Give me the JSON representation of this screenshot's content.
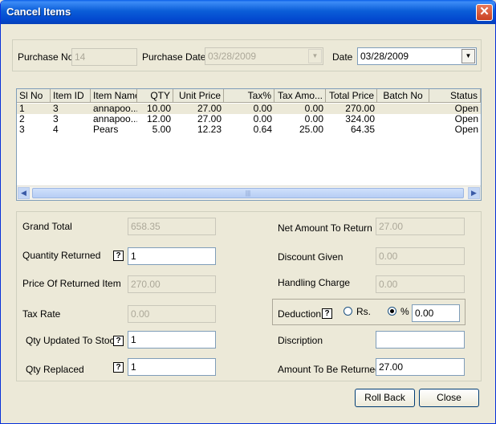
{
  "window": {
    "title": "Cancel Items",
    "close_glyph": "✕"
  },
  "top": {
    "purchase_no_label": "Purchase No",
    "purchase_no_value": "14",
    "purchase_date_label": "Purchase Date",
    "purchase_date_value": "03/28/2009",
    "date_label": "Date",
    "date_value": "03/28/2009",
    "dropdown_glyph": "▼"
  },
  "grid": {
    "columns": [
      "Sl No",
      "Item ID",
      "Item Name",
      "QTY",
      "Unit Price",
      "Tax%",
      "Tax Amo...",
      "Total Price",
      "Batch No",
      "Status"
    ],
    "rows": [
      [
        "1",
        "3",
        "annapoo...",
        "10.00",
        "27.00",
        "0.00",
        "0.00",
        "270.00",
        "",
        "Open"
      ],
      [
        "2",
        "3",
        "annapoo...",
        "12.00",
        "27.00",
        "0.00",
        "0.00",
        "324.00",
        "",
        "Open"
      ],
      [
        "3",
        "4",
        "Pears",
        "5.00",
        "12.23",
        "0.64",
        "25.00",
        "64.35",
        "",
        "Open"
      ]
    ],
    "scroll_left": "◀",
    "scroll_right": "▶",
    "thumb_grip": "|||"
  },
  "left": {
    "grand_total_label": "Grand Total",
    "grand_total_value": "658.35",
    "quantity_returned_label": "Quantity Returned",
    "quantity_returned_value": "1",
    "price_returned_label": "Price Of Returned Item",
    "price_returned_value": "270.00",
    "tax_rate_label": "Tax Rate",
    "tax_rate_value": "0.00",
    "qty_updated_label": "Qty Updated To Stock",
    "qty_updated_value": "1",
    "qty_replaced_label": "Qty Replaced",
    "qty_replaced_value": "1",
    "help_glyph": "?"
  },
  "right": {
    "net_amount_label": "Net Amount To Return",
    "net_amount_value": "27.00",
    "discount_label": "Discount Given",
    "discount_value": "0.00",
    "handling_label": "Handling Charge",
    "handling_value": "0.00",
    "deduction_label": "Deduction",
    "rs_label": "Rs.",
    "percent_label": "%",
    "deduction_value": "0.00",
    "description_label": "Discription",
    "description_value": "",
    "amount_returned_label": "Amount To Be Returned",
    "amount_returned_value": "27.00"
  },
  "buttons": {
    "rollback": "Roll Back",
    "close": "Close"
  }
}
